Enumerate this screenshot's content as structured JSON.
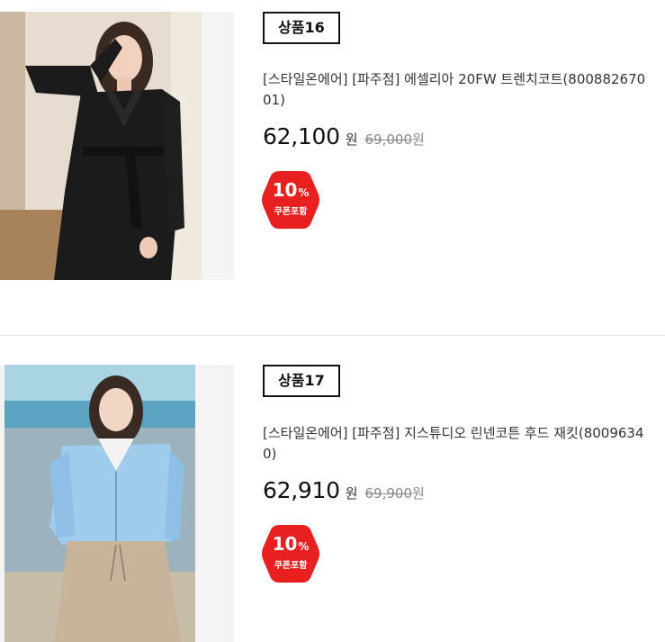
{
  "products": [
    {
      "badge": "상품16",
      "title": "[스타일온에어] [파주점] 에셀리아 20FW 트렌치코트(80088267001)",
      "price": "62,100",
      "price_unit": "원",
      "original_price": "69,000",
      "original_unit": "원",
      "coupon_percent": "10",
      "coupon_percent_sign": "%",
      "coupon_label": "쿠폰포함",
      "image_icon": "black-trench-coat-model-photo"
    },
    {
      "badge": "상품17",
      "title": "[스타일온에어] [파주점] 지스튜디오 린넨코튼 후드 재킷(80096340)",
      "price": "62,910",
      "price_unit": "원",
      "original_price": "69,900",
      "original_unit": "원",
      "coupon_percent": "10",
      "coupon_percent_sign": "%",
      "coupon_label": "쿠폰포함",
      "image_icon": "blue-hooded-jacket-model-photo"
    }
  ],
  "colors": {
    "coupon_red": "#e8201f",
    "badge_border": "#111111",
    "thumb_bg": "#f4f4f4"
  }
}
